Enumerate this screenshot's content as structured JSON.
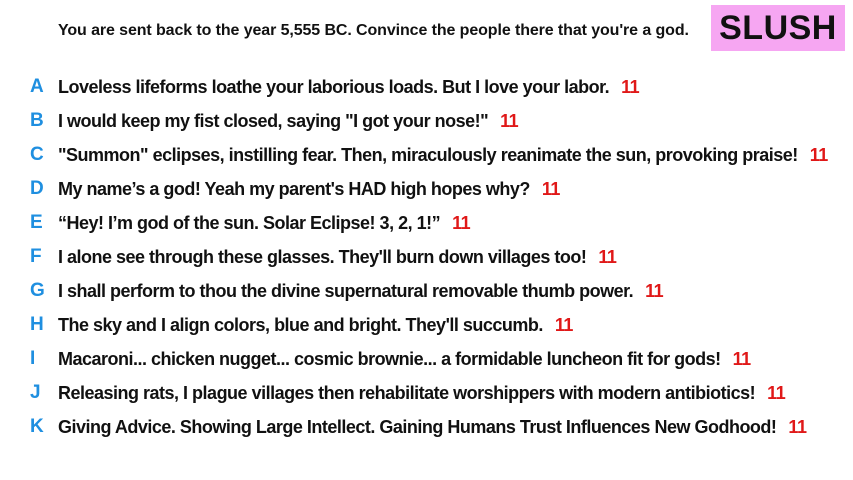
{
  "prompt": "You are sent back to the year 5,555 BC. Convince the people there that you're a god.",
  "badge": {
    "label": "SLUSH",
    "background": "#f6a6f2"
  },
  "colors": {
    "letter": "#1f8fe0",
    "score": "#e01818",
    "text": "#111111"
  },
  "answers": [
    {
      "letter": "A",
      "text": "Loveless lifeforms loathe your laborious loads. But I love your labor.",
      "score": "11"
    },
    {
      "letter": "B",
      "text": "I would keep my fist closed, saying \"I got your nose!\"",
      "score": "11"
    },
    {
      "letter": "C",
      "text": "\"Summon\" eclipses, instilling fear. Then, miraculously reanimate the sun, provoking praise!",
      "score": "11"
    },
    {
      "letter": "D",
      "text": "My name’s a god! Yeah my parent's HAD high hopes why?",
      "score": "11"
    },
    {
      "letter": "E",
      "text": "“Hey! I’m god of the sun. Solar Eclipse! 3, 2, 1!”",
      "score": "11"
    },
    {
      "letter": "F",
      "text": "I alone see through these glasses. They'll burn down villages too!",
      "score": "11"
    },
    {
      "letter": "G",
      "text": "I shall perform to thou the divine supernatural removable thumb power.",
      "score": "11"
    },
    {
      "letter": "H",
      "text": "The sky and I align colors, blue and bright. They'll succumb.",
      "score": "11"
    },
    {
      "letter": "I",
      "text": "Macaroni... chicken nugget... cosmic brownie...  a formidable luncheon fit for gods!",
      "score": "11"
    },
    {
      "letter": "J",
      "text": "Releasing rats, I plague villages then rehabilitate worshippers with modern antibiotics!",
      "score": "11"
    },
    {
      "letter": "K",
      "text": "Giving Advice. Showing Large Intellect. Gaining Humans Trust Influences New Godhood!",
      "score": "11"
    }
  ]
}
